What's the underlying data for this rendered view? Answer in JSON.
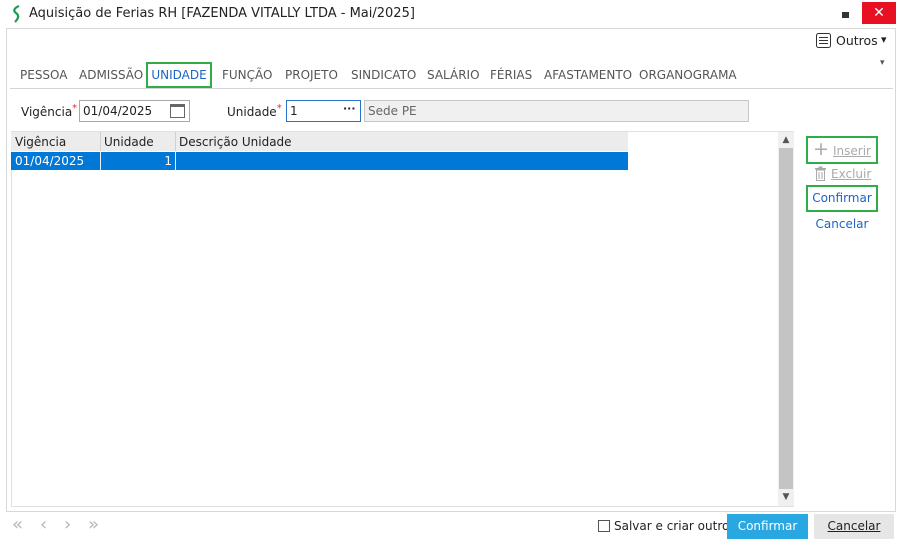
{
  "window": {
    "title": "Aquisição de Ferias RH [FAZENDA VITALLY LTDA - Mai/2025]",
    "close_glyph": "✕"
  },
  "toolbar": {
    "outros_label": "Outros",
    "outros_caret": "▾",
    "tabs_overflow": "▾"
  },
  "tabs": [
    {
      "label": "PESSOA"
    },
    {
      "label": "ADMISSÃO"
    },
    {
      "label": "UNIDADE",
      "active": true
    },
    {
      "label": "FUNÇÃO"
    },
    {
      "label": "PROJETO"
    },
    {
      "label": "SINDICATO"
    },
    {
      "label": "SALÁRIO"
    },
    {
      "label": "FÉRIAS"
    },
    {
      "label": "AFASTAMENTO"
    },
    {
      "label": "ORGANOGRAMA"
    }
  ],
  "form": {
    "vigencia_label": "Vigência",
    "required_mark": "*",
    "vigencia_value": "01/04/2025",
    "unidade_label": "Unidade",
    "unidade_value": "1",
    "lookup_dots": "···",
    "unidade_descricao": "Sede PE"
  },
  "grid": {
    "columns": [
      "Vigência",
      "Unidade",
      "Descrição Unidade"
    ],
    "rows": [
      {
        "vigencia": "01/04/2025",
        "unidade": "1",
        "descricao": "",
        "selected": true
      }
    ],
    "scroll_up": "▲",
    "scroll_down": "▼"
  },
  "actions": {
    "inserir": "Inserir",
    "excluir": "Excluir",
    "confirmar": "Confirmar",
    "cancelar": "Cancelar",
    "plus_glyph": "+"
  },
  "footer": {
    "first_glyph": "«",
    "prev_glyph": "‹",
    "next_glyph": "›",
    "last_glyph": "»",
    "salvar_criar_label": "Salvar e criar outro",
    "confirmar_label": "Confirmar",
    "cancelar_label": "Cancelar"
  },
  "colors": {
    "accent_green": "#2fae48",
    "selection_blue": "#0078d7",
    "confirm_blue": "#29a7e1",
    "close_red": "#e81123",
    "link_blue": "#1c64c4"
  }
}
